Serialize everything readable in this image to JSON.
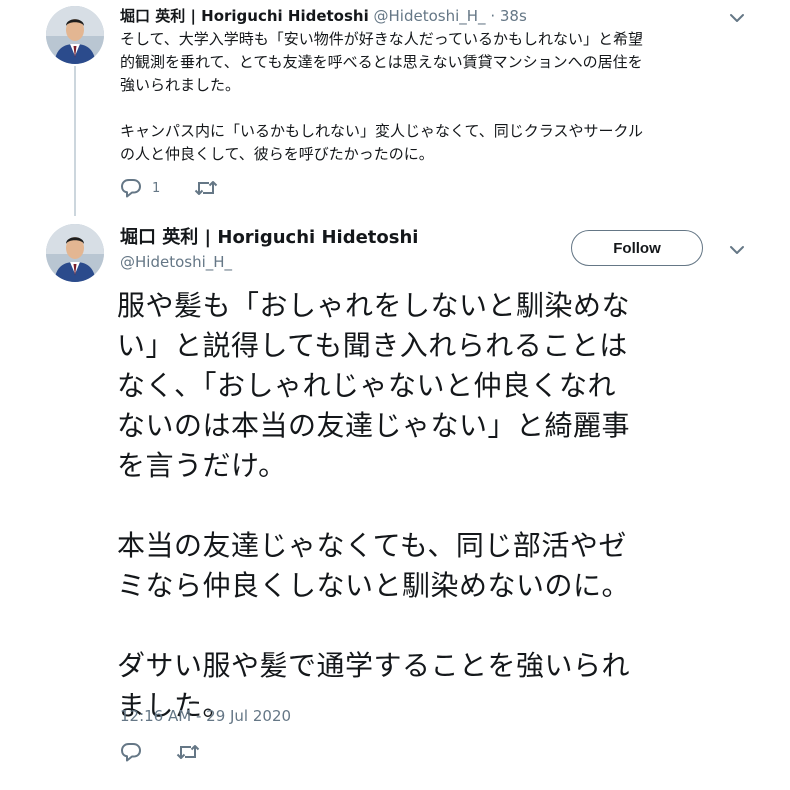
{
  "tweet1": {
    "author_name": "堀口 英利 | Horiguchi Hidetoshi",
    "handle": "@Hidetoshi_H_",
    "separator": "·",
    "time": "38s",
    "text": "そして、大学入学時も「安い物件が好きな人だっているかもしれない」と希望\n的観測を垂れて、とても友達を呼べるとは思えない賃貸マンションへの居住を\n強いられました。\n\nキャンパス内に「いるかもしれない」変人じゃなくて、同じクラスやサークル\nの人と仲良くして、彼らを呼びたかったのに。",
    "reply_count": "1",
    "icons": {
      "reply": "reply-icon",
      "retweet": "retweet-icon",
      "menu": "chevron-down-icon"
    }
  },
  "tweet2": {
    "author_name": "堀口 英利 | Horiguchi Hidetoshi",
    "handle": "@Hidetoshi_H_",
    "follow_label": "Follow",
    "text": "服や髪も「おしゃれをしないと馴染めな\nい」と説得しても聞き入れられることは\nなく、「おしゃれじゃないと仲良くなれ\nないのは本当の友達じゃない」と綺麗事\nを言うだけ。\n\n本当の友達じゃなくても、同じ部活やゼ\nミなら仲良くしないと馴染めないのに。\n\nダサい服や髪で通学することを強いられ\nました。",
    "timestamp": "12:16 AM - 29 Jul 2020",
    "icons": {
      "reply": "reply-icon",
      "retweet": "retweet-icon",
      "menu": "chevron-down-icon"
    }
  },
  "colors": {
    "text": "#14171a",
    "secondary": "#657786",
    "thread_line": "#ccd6dd",
    "background": "#ffffff"
  }
}
